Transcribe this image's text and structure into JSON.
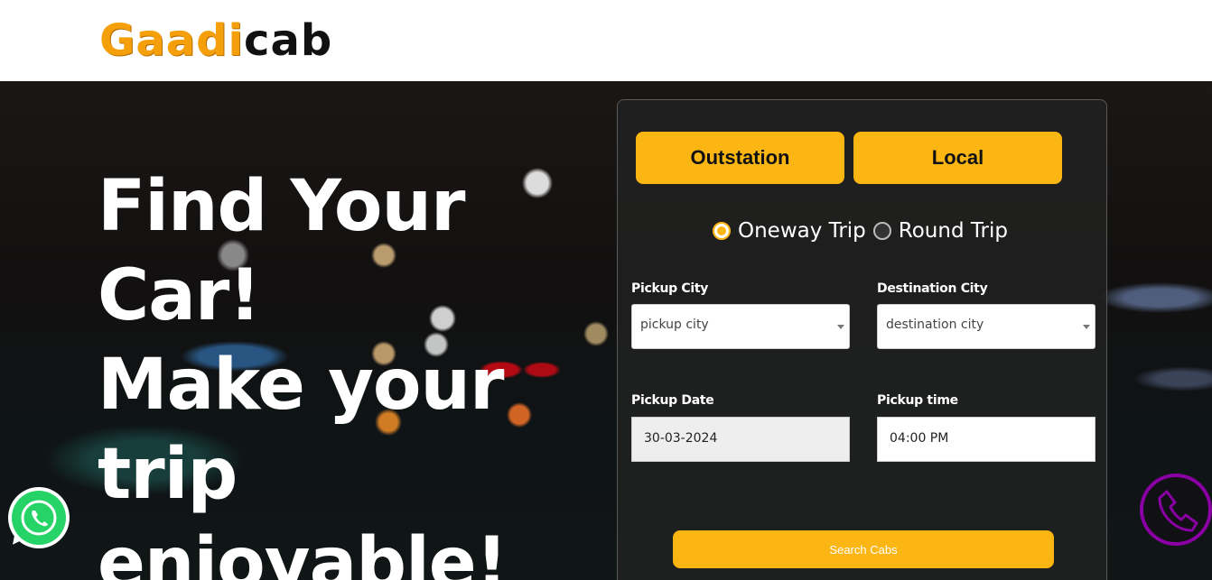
{
  "brand": {
    "logo_part1": "Gaadi",
    "logo_part2": "cab"
  },
  "hero": {
    "line1": "Find Your",
    "line2": "Car!",
    "line3": "Make your",
    "line4": "trip",
    "line5": "enjoyable!"
  },
  "booking": {
    "tabs": {
      "outstation": "Outstation",
      "local": "Local"
    },
    "trip_types": {
      "oneway": "Oneway Trip",
      "round": "Round Trip",
      "selected": "oneway"
    },
    "pickup_city": {
      "label": "Pickup City",
      "placeholder": "pickup city"
    },
    "destination_city": {
      "label": "Destination City",
      "placeholder": "destination city"
    },
    "pickup_date": {
      "label": "Pickup Date",
      "value": "30-03-2024"
    },
    "pickup_time": {
      "label": "Pickup time",
      "value": "04:00 PM"
    },
    "search_button": "Search Cabs"
  },
  "colors": {
    "accent": "#fcb614",
    "logo_orange": "#f5a00a",
    "call_purple": "#8b00a5",
    "whatsapp_green": "#25d366"
  },
  "icons": {
    "whatsapp": "whatsapp-icon",
    "call": "phone-icon"
  }
}
